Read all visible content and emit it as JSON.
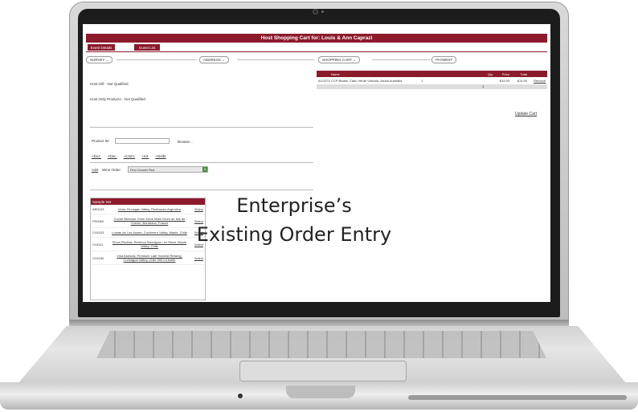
{
  "app": {
    "title": "Host Shopping Cart for: Louis & Ann Caprazi",
    "tabs": [
      {
        "label": "Event Details"
      },
      {
        "label": "Guest List"
      }
    ],
    "accent_color": "#8b1a2b"
  },
  "sections": {
    "survey": {
      "label": "SURVEY"
    },
    "address": {
      "label": "ADDRESS"
    },
    "cart": {
      "label": "SHOPPING CART"
    },
    "payment": {
      "label": "PAYMENT"
    }
  },
  "host_status": {
    "gift": "Host Gift - Not Qualified",
    "only_products": "Host Only Products - Not Qualified"
  },
  "product_search": {
    "label": "Product ID:",
    "browse": "Browse..."
  },
  "nav_links": [
    "+Doz.",
    "+Dec.",
    "+Ctsm.",
    "+Kit.",
    "+Dstbr"
  ],
  "wine_order": {
    "add_label": "Add",
    "label": "Wine Order",
    "selected": "First Growth Red"
  },
  "cart": {
    "columns": [
      "Name",
      "Qty.",
      "Price",
      "Total"
    ],
    "rows": [
      {
        "sku": "AC0273",
        "name": "CCP Braise, Cabo Verde Vinicola, Aruba Australia",
        "qty": "1",
        "price": "$14.90",
        "total": "$14.90",
        "action": "Remove"
      }
    ],
    "total_qty": "1",
    "update_label": "Update Cart"
  },
  "samples": {
    "title": "Sample Set",
    "items": [
      {
        "sku": "AR0103",
        "desc": "Viola, Finnegan Valley, Pertinaces Argentina",
        "action": "Select"
      },
      {
        "sku": "FR0062",
        "desc": "Cuvee Bretonie, Entin Deve Mars Drum an Isle de Chenin, Bordeaux, France",
        "action": "Select"
      },
      {
        "sku": "CH1103",
        "desc": "Lomas de Los Andes, Cochinero Valley, Maule, Chile",
        "action": "Select"
      },
      {
        "sku": "CH1111",
        "desc": "Finca Piedras, Reserva Sauvignon, en Rand, Maule Valley, Chile",
        "action": "Select"
      },
      {
        "sku": "CH1150",
        "desc": "Vina Asencia, Premium Late Harvest Riesling, Curicagua Valley, Chile 500 ml bottle",
        "action": "Select"
      }
    ]
  },
  "caption": {
    "line1": "Enterprise’s",
    "line2": "Existing Order Entry"
  }
}
